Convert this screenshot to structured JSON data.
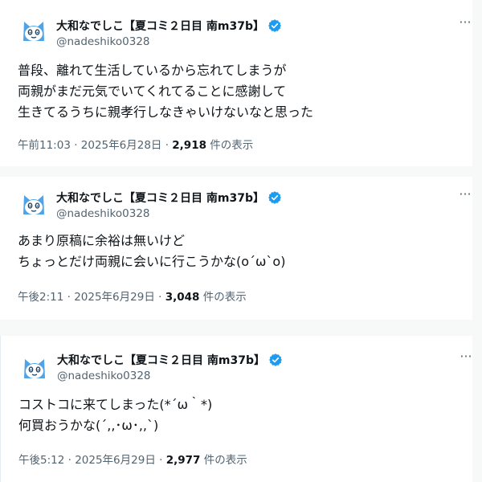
{
  "posts": [
    {
      "display_name": "大和なでしこ【夏コミ２日目 南m37b】",
      "handle": "@nadeshiko0328",
      "more_label": "···",
      "lines": [
        "普段、離れて生活しているから忘れてしまうが",
        "両親がまだ元気でいてくれてることに感謝して",
        "生きてるうちに親孝行しなきゃいけないなと思った"
      ],
      "time": "午前11:03",
      "date": "2025年6月28日",
      "views": "2,918",
      "views_label": "件の表示"
    },
    {
      "display_name": "大和なでしこ【夏コミ２日目 南m37b】",
      "handle": "@nadeshiko0328",
      "more_label": "···",
      "lines": [
        "あまり原稿に余裕は無いけど",
        "ちょっとだけ両親に会いに行こうかな(o´ω`o)"
      ],
      "time": "午後2:11",
      "date": "2025年6月29日",
      "views": "3,048",
      "views_label": "件の表示"
    },
    {
      "display_name": "大和なでしこ【夏コミ２日目 南m37b】",
      "handle": "@nadeshiko0328",
      "more_label": "···",
      "lines": [
        "コストコに来てしまった(*´ω｀*)",
        "何買おうかな(´,,･ω･,,`)"
      ],
      "time": "午後5:12",
      "date": "2025年6月29日",
      "views": "2,977",
      "views_label": "件の表示"
    }
  ],
  "icons": {
    "avatar": "cat-mascot-avatar",
    "verified": "verified-badge-icon",
    "more": "more-options-icon"
  },
  "colors": {
    "verified": "#1d9bf0",
    "avatar_blue": "#4fa3e6",
    "secondary_text": "#536471",
    "primary_text": "#0f1419",
    "background": "#f7f9f9"
  }
}
